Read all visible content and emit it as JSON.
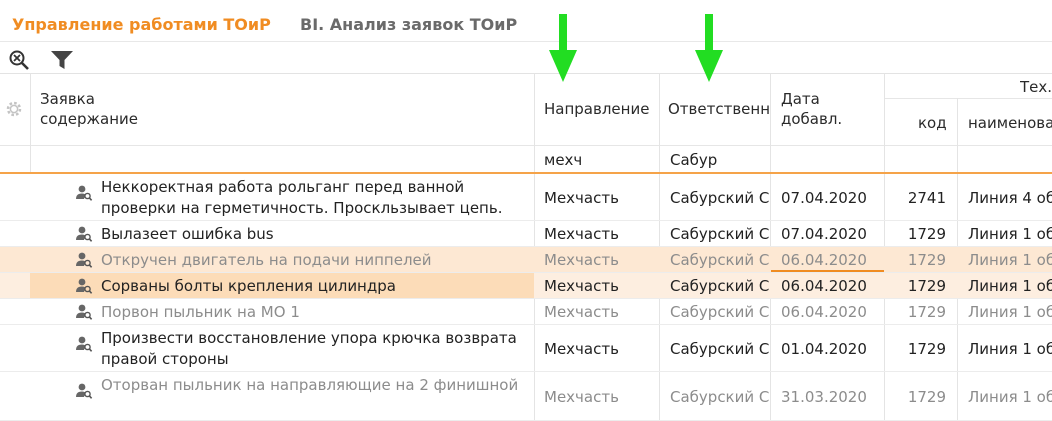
{
  "tabs": {
    "active": "Управление работами ТОиР",
    "other": "BI. Анализ заявок ТОиР"
  },
  "toolbar": {
    "zoom_icon": "zoom-reset-icon",
    "filter_icon": "filter-icon"
  },
  "columns": {
    "request_line1": "Заявка",
    "request_line2": "содержание",
    "direction": "Направление",
    "responsible": "Ответственный",
    "date_line1": "Дата",
    "date_line2": "добавл.",
    "tech_group": "Тех.место",
    "code": "код",
    "name": "наименование"
  },
  "filters": {
    "direction": "мехч",
    "responsible": "Сабур"
  },
  "rows": [
    {
      "desc": "Неккоректная работа рольганг перед ванной проверки на герметичность. Проскльзывает цепь.",
      "direction": "Мехчасть",
      "responsible": "Сабурский С",
      "date": "07.04.2020",
      "code": "2741",
      "name": "Линия 4 об"
    },
    {
      "desc": "Вылазеет ошибка bus",
      "direction": "Мехчасть",
      "responsible": "Сабурский С",
      "date": "07.04.2020",
      "code": "1729",
      "name": "Линия 1 об"
    },
    {
      "desc": "Откручен двигатель на подачи ниппелей",
      "direction": "Мехчасть",
      "responsible": "Сабурский С",
      "date": "06.04.2020",
      "code": "1729",
      "name": "Линия 1 об"
    },
    {
      "desc": "Сорваны болты крепления цилиндра",
      "direction": "Мехчасть",
      "responsible": "Сабурский С",
      "date": "06.04.2020",
      "code": "1729",
      "name": "Линия 1 об"
    },
    {
      "desc": "Порвон пыльник на МО 1",
      "direction": "Мехчасть",
      "responsible": "Сабурский С",
      "date": "06.04.2020",
      "code": "1729",
      "name": "Линия 1 об"
    },
    {
      "desc": "Произвести восстановление упора крючка возврата правой стороны",
      "direction": "Мехчасть",
      "responsible": "Сабурский С",
      "date": "01.04.2020",
      "code": "1729",
      "name": "Линия 1 об"
    },
    {
      "desc": "Оторван пыльник на направляющие на 2 финишной",
      "direction": "Мехчасть",
      "responsible": "Сабурский С",
      "date": "31.03.2020",
      "code": "1729",
      "name": "Линия 1 об"
    }
  ],
  "colors": {
    "accent": "#f08c22",
    "arrow": "#22dd22",
    "selected_row": "#fcdcb8",
    "hover_row": "#fde8d3"
  }
}
